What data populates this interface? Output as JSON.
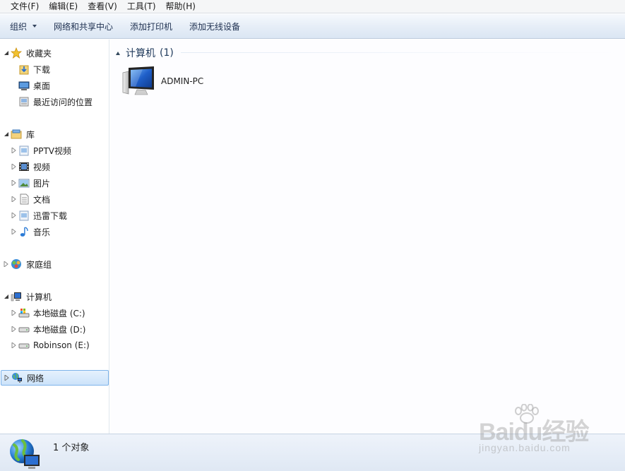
{
  "menubar": {
    "items": [
      "文件(F)",
      "编辑(E)",
      "查看(V)",
      "工具(T)",
      "帮助(H)"
    ]
  },
  "commandbar": {
    "organize": "组织",
    "network_center": "网络和共享中心",
    "add_printer": "添加打印机",
    "add_wireless": "添加无线设备"
  },
  "nav": {
    "favorites": {
      "label": "收藏夹",
      "items": [
        "下载",
        "桌面",
        "最近访问的位置"
      ]
    },
    "libraries": {
      "label": "库",
      "items": [
        "PPTV视频",
        "视频",
        "图片",
        "文档",
        "迅雷下载",
        "音乐"
      ]
    },
    "homegroup": {
      "label": "家庭组"
    },
    "computer": {
      "label": "计算机",
      "items": [
        "本地磁盘 (C:)",
        "本地磁盘 (D:)",
        "Robinson (E:)"
      ]
    },
    "network": {
      "label": "网络"
    }
  },
  "content": {
    "group_label": "计算机",
    "group_count": "(1)",
    "computer_name": "ADMIN-PC"
  },
  "status": {
    "text": "1 个对象"
  },
  "watermark": {
    "logo": "Baidu经验",
    "sub": "jingyan.baidu.com"
  },
  "colors": {
    "accent": "#1e395b",
    "selection_border": "#7eb4ea",
    "commandbar_top": "#f6f9fd",
    "commandbar_bottom": "#dbe6f3"
  }
}
